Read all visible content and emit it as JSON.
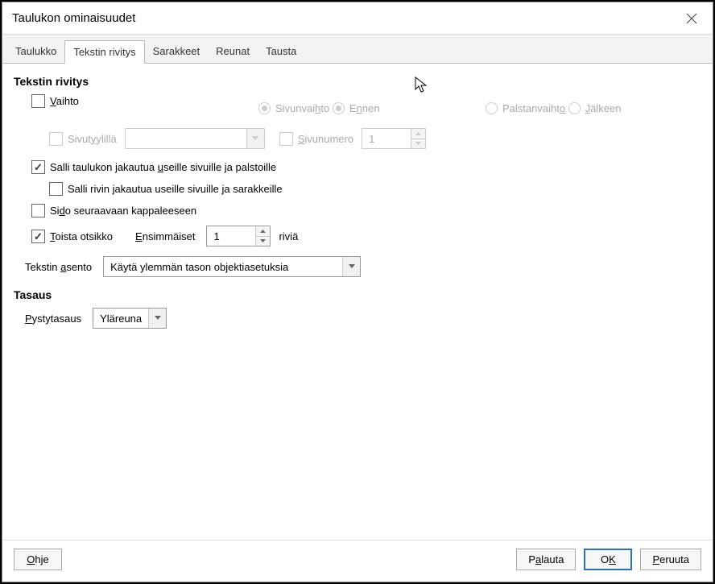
{
  "title": "Taulukon ominaisuudet",
  "tabs": [
    "Taulukko",
    "Tekstin rivitys",
    "Sarakkeet",
    "Reunat",
    "Tausta"
  ],
  "active_tab": 1,
  "section1": {
    "title": "Tekstin rivitys",
    "vaihto": {
      "label_pre": "",
      "label_u": "V",
      "label_post": "aihto",
      "checked": false
    },
    "sivunvaihto": {
      "label_pre": "Sivunvai",
      "label_u": "h",
      "label_post": "to",
      "checked": true
    },
    "palstanvaihto": {
      "label_pre": "Palstanvaiht",
      "label_u": "o",
      "label_post": "",
      "checked": false
    },
    "ennen": {
      "label_pre": "E",
      "label_u": "n",
      "label_post": "nen",
      "checked": true
    },
    "jalkeen": {
      "label_pre": "",
      "label_u": "J",
      "label_post": "älkeen",
      "checked": false
    },
    "sivutyylilla": {
      "label_pre": "Sivut",
      "label_u": "y",
      "label_post": "ylillä",
      "checked": false,
      "value": ""
    },
    "sivunumero": {
      "label_pre": "",
      "label_u": "S",
      "label_post": "ivunumero",
      "checked": false,
      "value": "1"
    },
    "salli_taulukon": {
      "label_pre": "Salli taulukon jakautua ",
      "label_u": "u",
      "label_post": "seille sivuille ja palstoille",
      "checked": true
    },
    "salli_rivin": {
      "label": "Salli rivin jakautua useille sivuille ja sarakkeille",
      "checked": false
    },
    "sido": {
      "label_pre": "Si",
      "label_u": "d",
      "label_post": "o seuraavaan kappaleeseen",
      "checked": false
    },
    "toista": {
      "label_pre": "",
      "label_u": "T",
      "label_post": "oista otsikko",
      "checked": true
    },
    "ensimmaiset": {
      "label_pre": "",
      "label_u": "E",
      "label_post": "nsimmäiset",
      "value": "1",
      "unit": "riviä"
    },
    "asento": {
      "label_pre": "Tekstin ",
      "label_u": "a",
      "label_post": "sento",
      "value": "Käytä ylemmän tason objektiasetuksia"
    }
  },
  "section2": {
    "title": "Tasaus",
    "pysty": {
      "label_pre": "",
      "label_u": "P",
      "label_post": "ystytasaus",
      "value": "Yläreuna"
    }
  },
  "buttons": {
    "ohje": {
      "pre": "",
      "u": "O",
      "post": "hje"
    },
    "palauta": {
      "pre": "P",
      "u": "a",
      "post": "lauta"
    },
    "ok": {
      "pre": "O",
      "u": "K",
      "post": ""
    },
    "peruuta": {
      "pre": "",
      "u": "P",
      "post": "eruuta"
    }
  }
}
